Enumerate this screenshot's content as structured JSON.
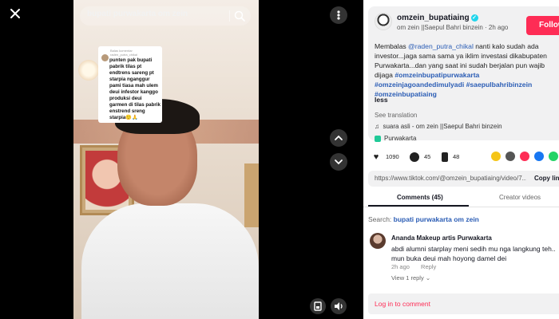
{
  "search": {
    "query": "bupati purwakarta om zein"
  },
  "sticker": {
    "meta": "Balas komentar\nraden_putra_chikal",
    "text": "punten pak bupati pabrik tilas pt endtrens sareng pt starpia nganggur pami tiasa mah ulem deui infestor kanggo produksi deui garmen di tilas pabrik enstrend sreng starpia🙂🙏"
  },
  "post": {
    "author_handle": "omzein_bupatiaing",
    "author_sub": "om zein ||Saepul Bahri binzein · 2h ago",
    "follow_label": "Follow",
    "desc_prefix": "Membalas ",
    "desc_mention": "@raden_putra_chikal",
    "desc_body": " nanti kalo sudah ada investor...jaga sama sama ya iklim investasi dikabupaten Purwakarta...dan yang saat ini sudah berjalan pun wajib dijaga ",
    "hashtags": "#omzeinbupatipurwakarta #omzeinjagoandedimulyadi #saepulbahribinzein #omzeinbupatiaing",
    "less_label": "less",
    "see_translation": "See translation",
    "music": "suara asli - om zein ||Saepul Bahri binzein",
    "location": "Purwakarta"
  },
  "actions": {
    "likes": "1090",
    "comments": "45",
    "saves": "48"
  },
  "share": {
    "url": "https://www.tiktok.com/@omzein_bupatiaing/video/7...",
    "copy_label": "Copy link"
  },
  "tabs": [
    {
      "label": "Comments (45)",
      "active": true
    },
    {
      "label": "Creator videos",
      "active": false
    }
  ],
  "comments_search": {
    "prefix": "Search: ",
    "keyword": "bupati purwakarta om zein"
  },
  "comment": {
    "author": "Ananda Makeup artis Purwakarta",
    "text": "abdi alumni starplay meni sedih mu nga langkung teh.. mun buka deui mah hoyong damel dei",
    "time": "2h ago",
    "reply_label": "Reply",
    "view_replies": "View 1 reply"
  },
  "login": {
    "label": "Log in to comment"
  },
  "colors": {
    "accent": "#fe2c55",
    "link": "#2b5db5",
    "verified": "#20d5ec"
  },
  "icons": [
    "close-icon",
    "search-icon",
    "more-icon",
    "chevron-up-icon",
    "chevron-down-icon",
    "miniplayer-icon",
    "volume-icon",
    "heart-icon",
    "comment-icon",
    "bookmark-icon",
    "music-icon",
    "location-icon",
    "share-icons"
  ]
}
